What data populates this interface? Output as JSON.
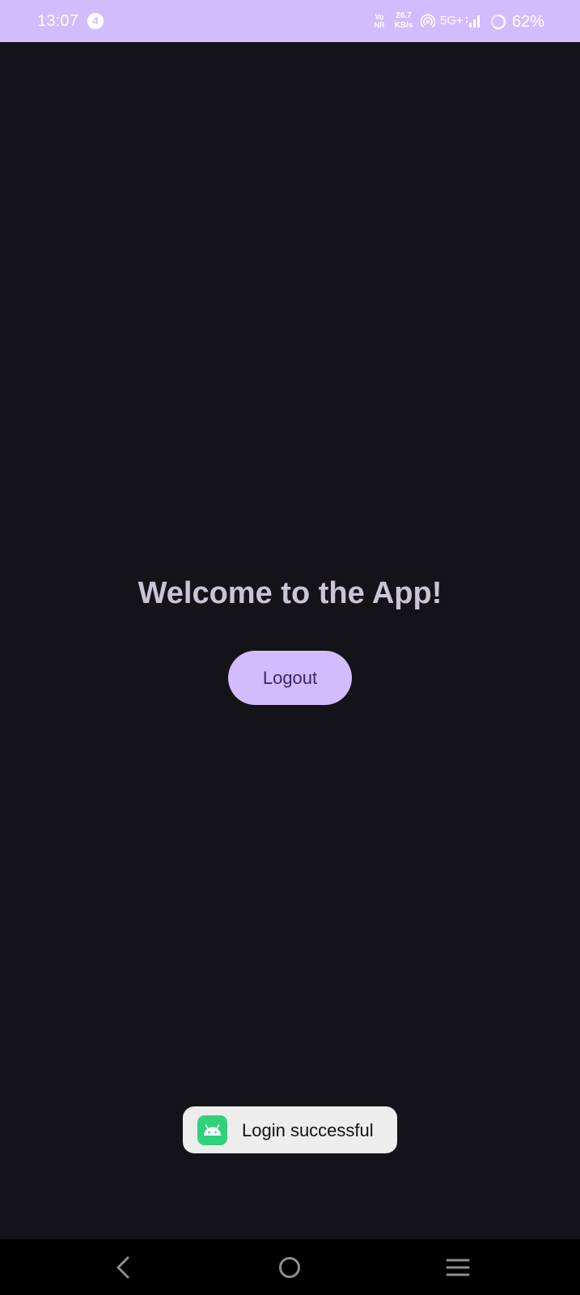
{
  "status_bar": {
    "time": "13:07",
    "notification_count": "4",
    "volte_line1": "Vo",
    "volte_line2": "NR",
    "net_speed_value": "26.7",
    "net_speed_unit": "KB/s",
    "network_type": "5G+",
    "battery_percent": "62%",
    "icons": [
      "hotspot-icon",
      "signal-icon",
      "battery-icon"
    ]
  },
  "main": {
    "welcome_title": "Welcome to the App!",
    "logout_label": "Logout"
  },
  "toast": {
    "app_icon": "android-icon",
    "message": "Login successful"
  },
  "nav_bar": {
    "icons": [
      "back-icon",
      "home-icon",
      "recents-icon"
    ]
  },
  "colors": {
    "background": "#15131a",
    "accent": "#d3bcfd",
    "title_text": "#cbc3d6",
    "button_text": "#3a2766",
    "toast_bg": "#ededed",
    "android_green": "#2fd27a"
  }
}
